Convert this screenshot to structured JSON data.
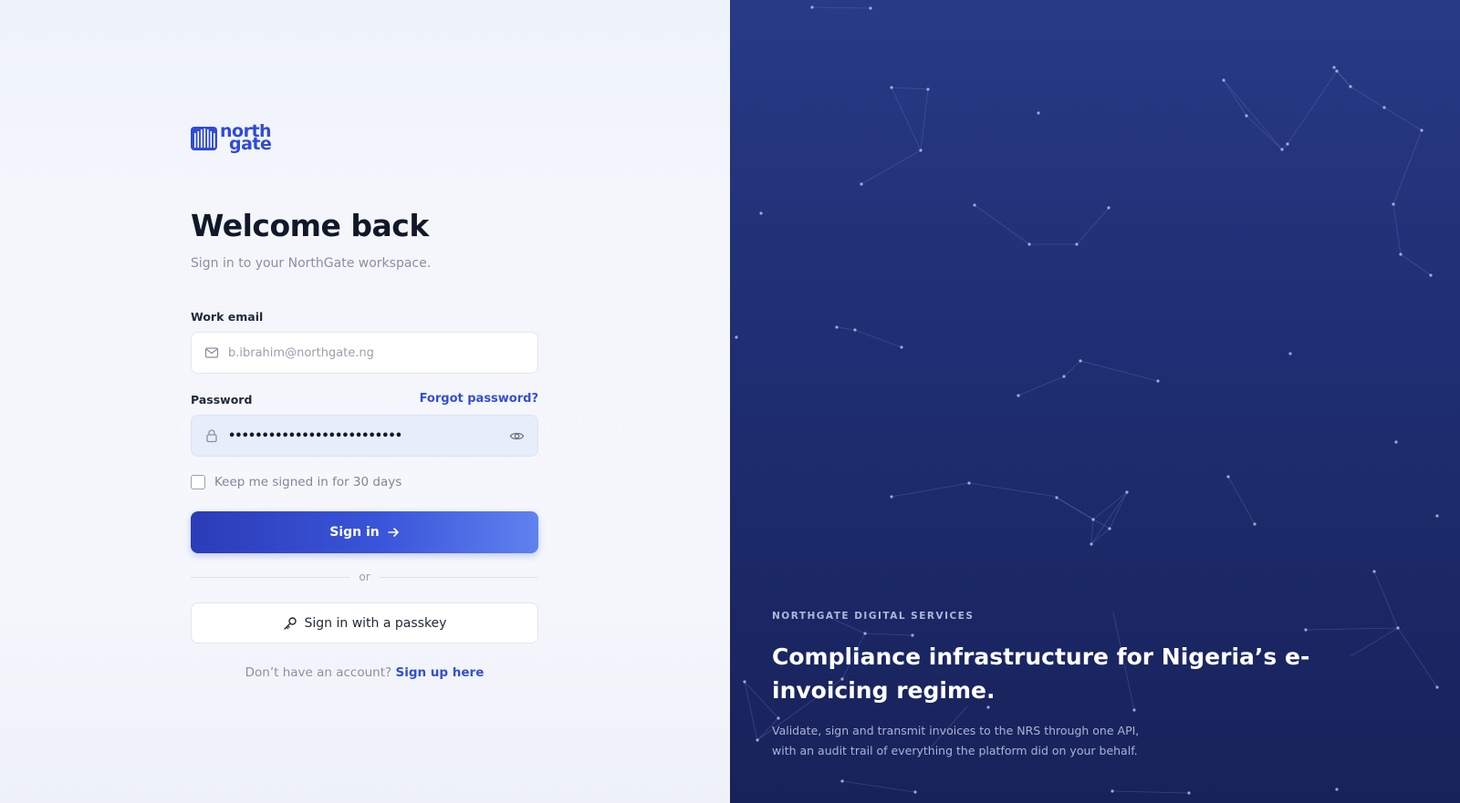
{
  "brand": {
    "logo_line1": "north",
    "logo_line2": "gate",
    "primary_color": "#3350d0",
    "icon": "building-bars-icon"
  },
  "login": {
    "title": "Welcome back",
    "subtitle": "Sign in to your NorthGate workspace.",
    "email": {
      "label": "Work email",
      "placeholder": "b.ibrahim@northgate.ng",
      "value": "",
      "icon": "mail-icon"
    },
    "password": {
      "label": "Password",
      "masked_value": "••••••••••••••••••••••••••",
      "forgot_label": "Forgot password?",
      "icon": "lock-icon",
      "toggle_icon": "eye-icon"
    },
    "remember": {
      "label": "Keep me signed in for 30 days",
      "checked": false
    },
    "signin_button": "Sign in",
    "signin_icon": "arrow-right-icon",
    "divider_text": "or",
    "passkey_button": "Sign in with a passkey",
    "passkey_icon": "key-icon",
    "signup_prompt": "Don’t have an account?",
    "signup_link": "Sign up here"
  },
  "promo": {
    "kicker": "NORTHGATE DIGITAL SERVICES",
    "headline": "Compliance infrastructure for Nigeria’s e-invoicing regime.",
    "description": "Validate, sign and transmit invoices to the NRS through one API, with an audit trail of everything the platform did on your behalf.",
    "background_color": "#1f2e72"
  }
}
